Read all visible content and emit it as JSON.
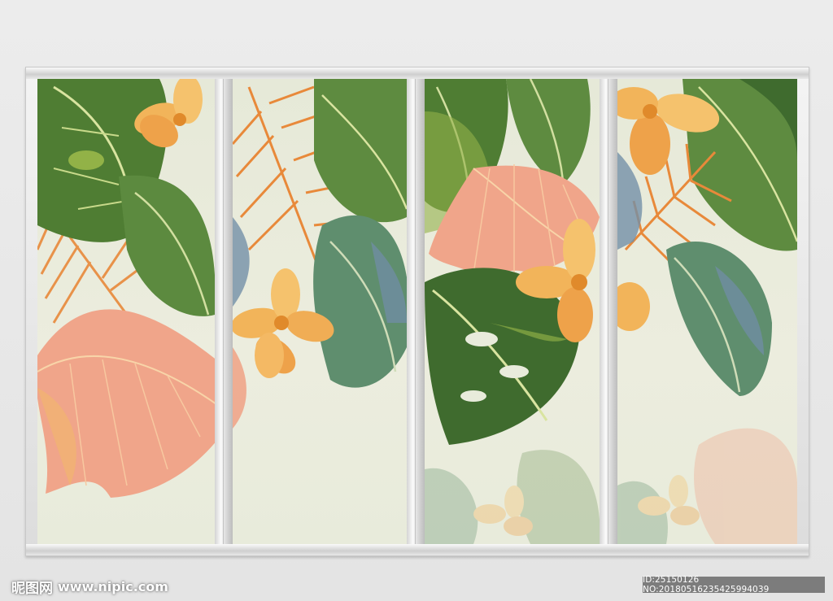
{
  "image": {
    "subject": "tropical leaves and flowers four-panel wall art",
    "panel_count": 4,
    "colors": {
      "background": "#e4e4e4",
      "canvas": "#e8ebdb",
      "leaf_dark": "#3f6b2e",
      "leaf_light": "#a9c25a",
      "leaf_blue": "#6f8da3",
      "flower": "#f2b45a",
      "fan_leaf": "#f0a58a",
      "fern": "#e8893a"
    }
  },
  "watermark": {
    "site_name": "昵图网",
    "url": "www.nipic.com",
    "id_text": "ID:25150126 NO:20180516235425994039"
  }
}
